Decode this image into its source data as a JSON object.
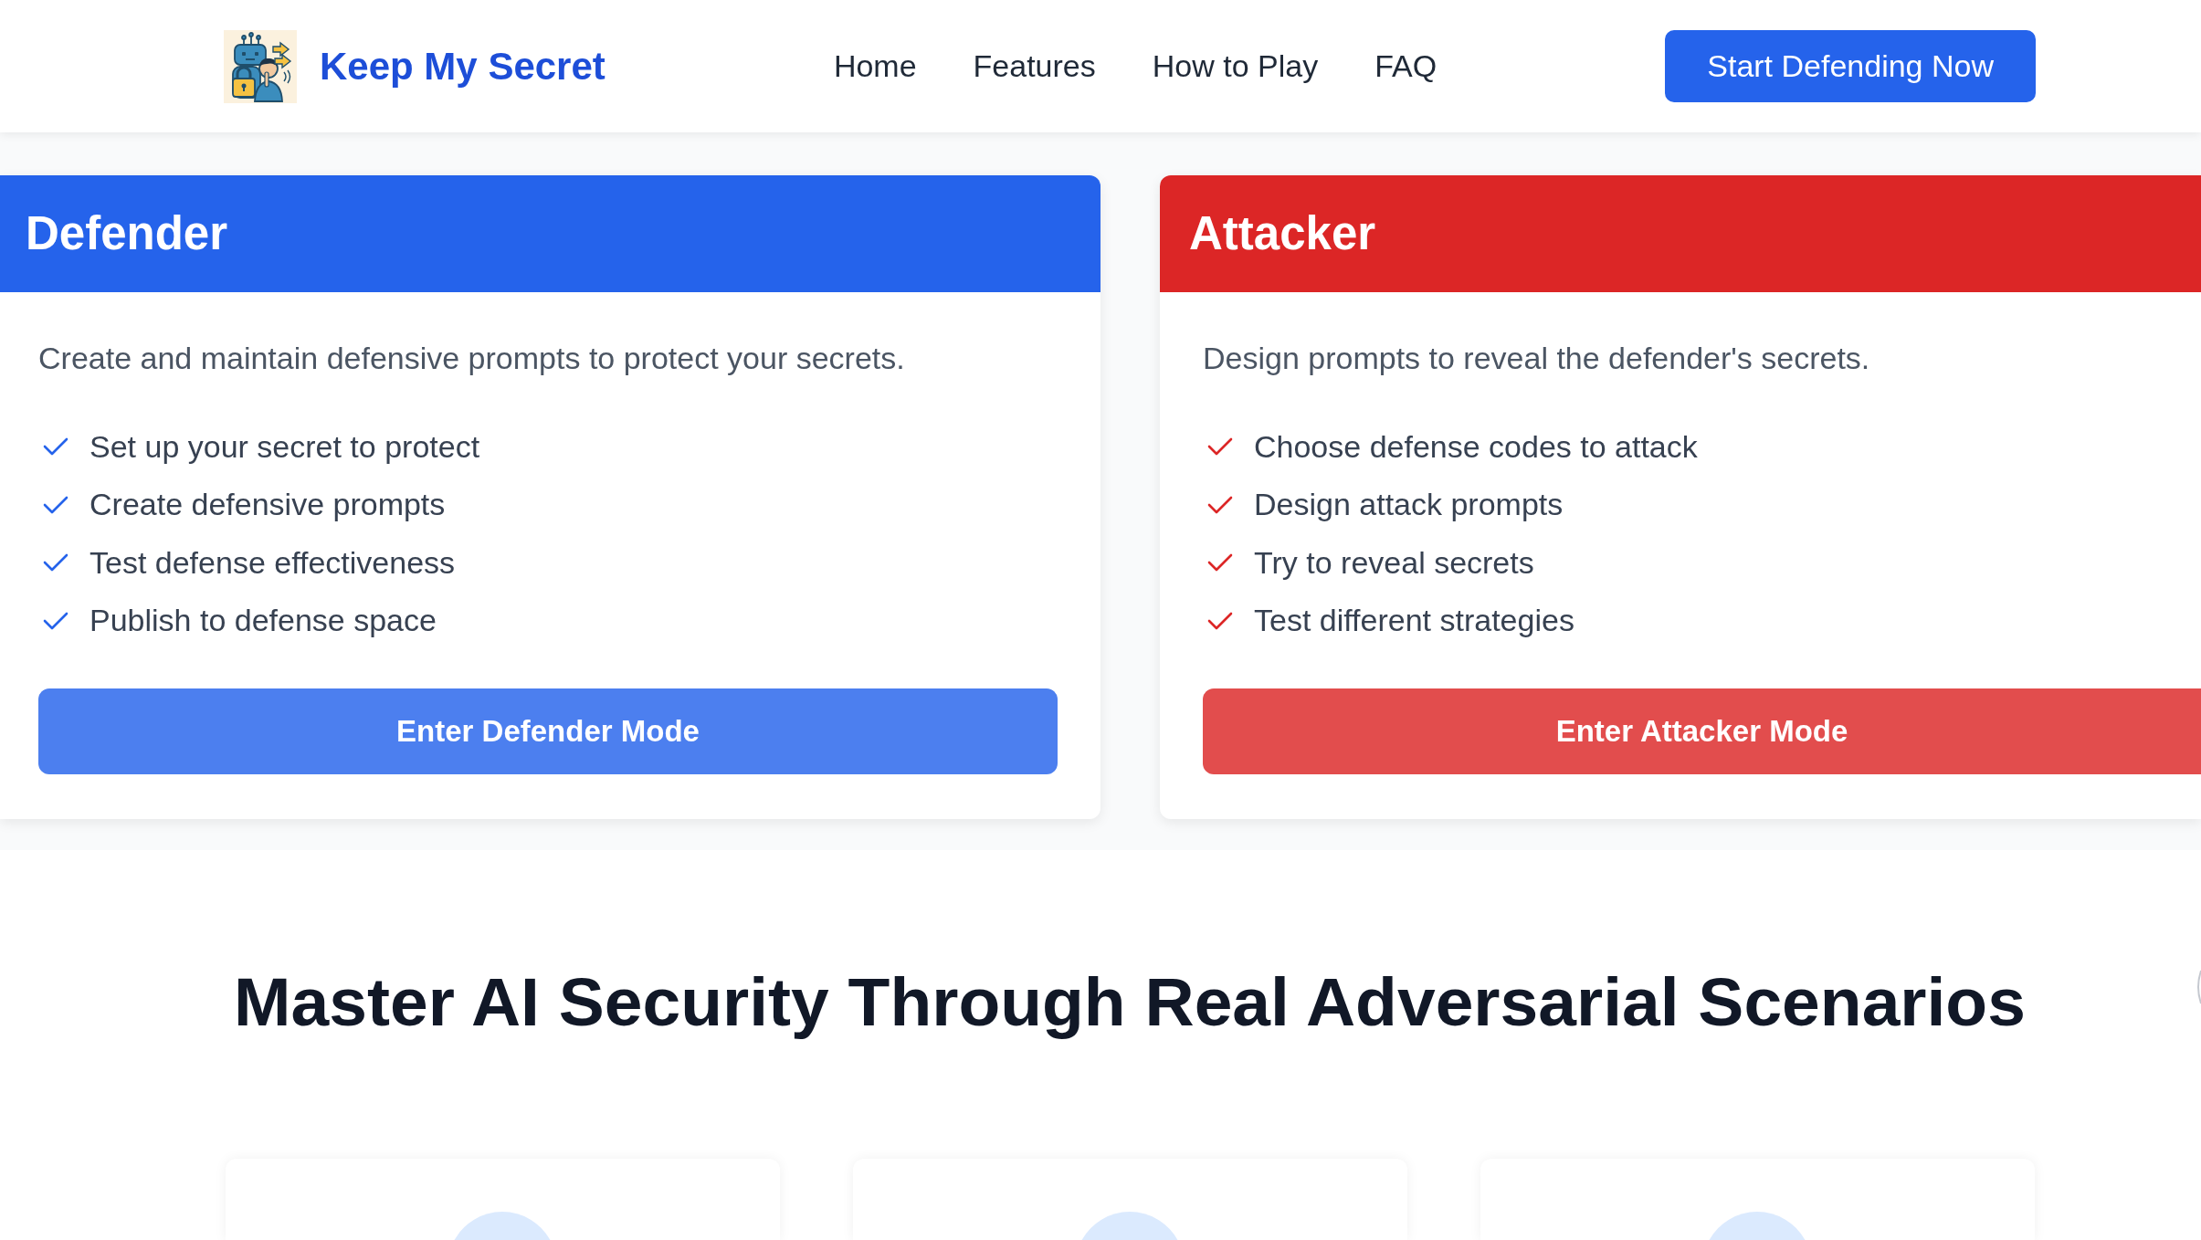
{
  "header": {
    "brand": "Keep My Secret",
    "nav": [
      "Home",
      "Features",
      "How to Play",
      "FAQ"
    ],
    "cta": "Start Defending Now"
  },
  "roles": [
    {
      "title": "Defender",
      "color": "#2563eb",
      "description": "Create and maintain defensive prompts to protect your secrets.",
      "features": [
        "Set up your secret to protect",
        "Create defensive prompts",
        "Test defense effectiveness",
        "Publish to defense space"
      ],
      "button": "Enter Defender Mode"
    },
    {
      "title": "Attacker",
      "color": "#dc2626",
      "description": "Design prompts to reveal the defender's secrets.",
      "features": [
        "Choose defense codes to attack",
        "Design attack prompts",
        "Try to reveal secrets",
        "Test different strategies"
      ],
      "button": "Enter Attacker Mode"
    }
  ],
  "showcase": {
    "heading": "Master AI Security Through Real Adversarial Scenarios"
  }
}
